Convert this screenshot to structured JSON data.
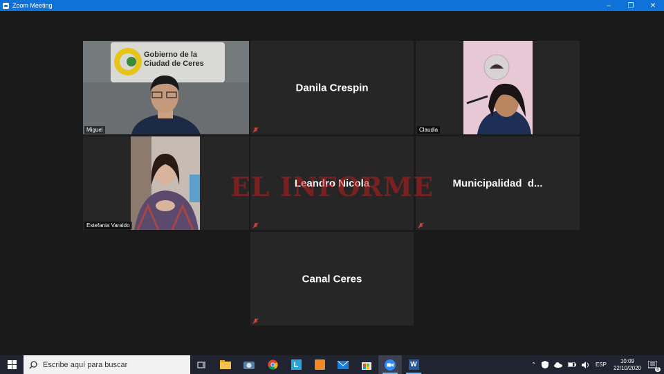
{
  "window": {
    "title": "Zoom Meeting"
  },
  "window_controls": {
    "minimize": "–",
    "maximize": "❐",
    "close": "✕"
  },
  "participants": [
    {
      "name": "Miguel",
      "video": true,
      "active_speaker": true,
      "background_sign": {
        "line1": "Gobierno de la",
        "line2": "Ciudad de Ceres"
      }
    },
    {
      "name": "Danila Crespin",
      "video": false,
      "muted": true
    },
    {
      "name": "Claudia",
      "video": true
    },
    {
      "name": "Estefania Varaldo",
      "video": true
    },
    {
      "name": "Leandro Nicola",
      "video": false,
      "muted": true
    },
    {
      "name": "Municipalidad  d...",
      "video": false,
      "muted": true
    },
    {
      "name": "Canal Ceres",
      "video": false,
      "muted": true
    }
  ],
  "watermark": "EL INFORME",
  "taskbar": {
    "search_placeholder": "Escribe aquí para buscar",
    "apps": [
      "task-view",
      "file-explorer",
      "camera",
      "chrome",
      "l-app",
      "paint-app",
      "mail",
      "store",
      "zoom",
      "word"
    ],
    "language": "ESP",
    "time": "10:09",
    "date": "22/10/2020",
    "notifications_count": "6"
  },
  "colors": {
    "titlebar": "#0e72d8",
    "active_speaker_border": "#c9ea5a",
    "tile_bg": "#262626",
    "mute_icon": "#e0473f",
    "watermark": "#be1e1e"
  }
}
